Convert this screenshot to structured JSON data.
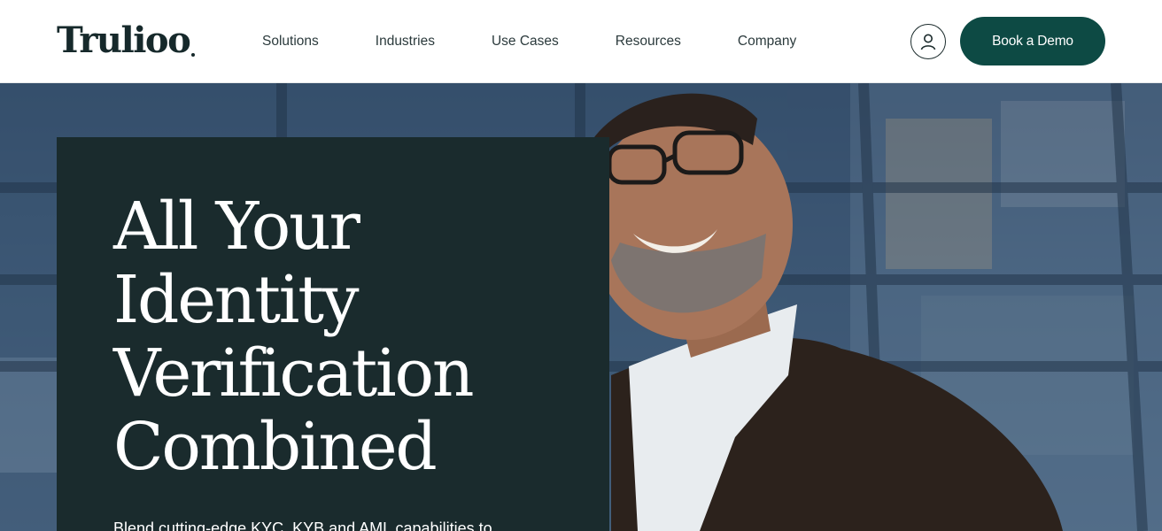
{
  "brand": {
    "name": "Trulioo",
    "primary_color": "#0d4a44",
    "dark_panel_color": "#1a2b2d"
  },
  "nav": {
    "items": [
      {
        "label": "Solutions"
      },
      {
        "label": "Industries"
      },
      {
        "label": "Use Cases"
      },
      {
        "label": "Resources"
      },
      {
        "label": "Company"
      }
    ],
    "account_icon": "user-icon",
    "cta_label": "Book a Demo"
  },
  "hero": {
    "title_lines": [
      "All Your",
      "Identity",
      "Verification",
      "Combined"
    ],
    "subtitle": "Blend cutting-edge KYC, KYB and AML capabilities to"
  }
}
